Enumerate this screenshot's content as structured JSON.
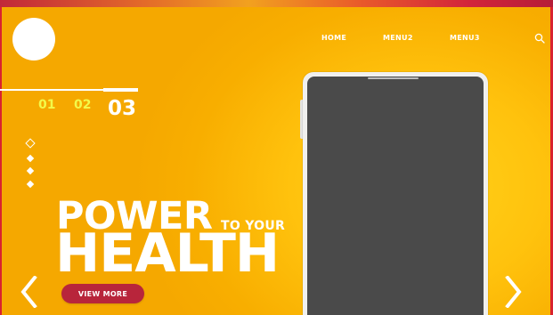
{
  "nav": {
    "items": [
      "HOME",
      "MENU2",
      "MENU3"
    ]
  },
  "slider": {
    "numbers": [
      "01",
      "02",
      "03"
    ],
    "active_index": 2,
    "dots_count": 4
  },
  "hero": {
    "headline_line1": "POWER",
    "headline_suffix": "TO YOUR",
    "headline_line2": "HEALTH",
    "cta_label": "VIEW MORE"
  },
  "colors": {
    "background": "#f8b400",
    "accent_button": "#b8253b",
    "slide_number_inactive": "#f3f94a",
    "phone_screen": "#4a4a4a"
  },
  "icons": {
    "search": "search-icon",
    "prev": "chevron-left-icon",
    "next": "chevron-right-icon"
  }
}
